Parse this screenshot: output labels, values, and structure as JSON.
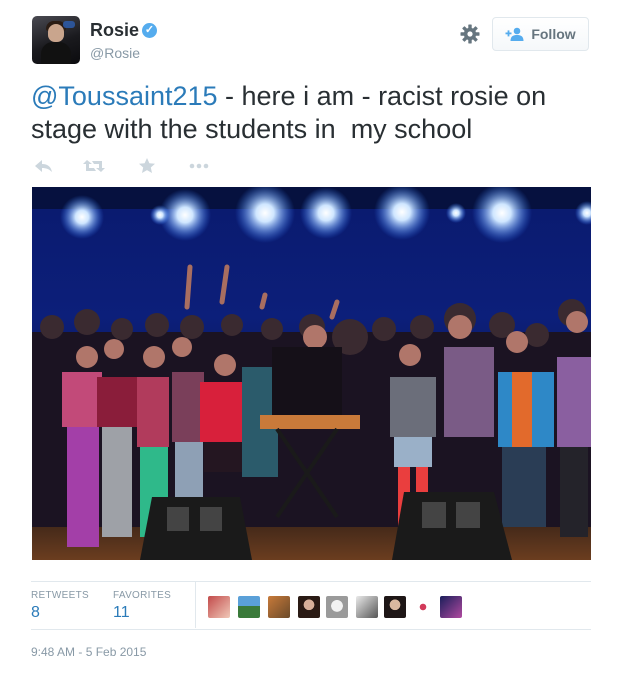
{
  "user": {
    "name": "Rosie",
    "handle": "@Rosie"
  },
  "header": {
    "follow_label": "Follow",
    "settings_icon": "gear-icon",
    "verified_icon": "verified-badge-icon"
  },
  "tweet": {
    "mention": "@Toussaint215",
    "text": " - here i am - racist rosie on stage with the students in  my school"
  },
  "actions": [
    {
      "name": "reply-icon"
    },
    {
      "name": "retweet-icon"
    },
    {
      "name": "favorite-icon"
    },
    {
      "name": "more-icon"
    }
  ],
  "stats": {
    "retweets_label": "RETWEETS",
    "retweets_value": "8",
    "favorites_label": "FAVORITES",
    "favorites_value": "11"
  },
  "timestamp": "9:48 AM - 5 Feb 2015",
  "colors": {
    "link": "#2b7bb9",
    "verified": "#55acee",
    "muted": "#8899a6",
    "text": "#292f33"
  }
}
